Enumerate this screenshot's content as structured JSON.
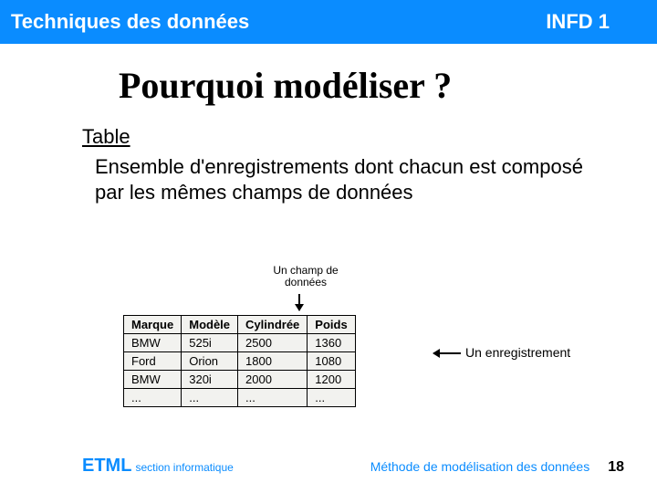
{
  "header": {
    "left": "Techniques des données",
    "right": "INFD 1"
  },
  "slide_title": "Pourquoi modéliser ?",
  "term": "Table",
  "definition": "Ensemble d'enregistrements dont chacun est composé par les mêmes champs de données",
  "annot_top": "Un champ de données",
  "annot_right": "Un enregistrement",
  "table": {
    "headers": [
      "Marque",
      "Modèle",
      "Cylindrée",
      "Poids"
    ],
    "rows": [
      [
        "BMW",
        "525i",
        "2500",
        "1360"
      ],
      [
        "Ford",
        "Orion",
        "1800",
        "1080"
      ],
      [
        "BMW",
        "320i",
        "2000",
        "1200"
      ],
      [
        "...",
        "...",
        "...",
        "..."
      ]
    ]
  },
  "footer": {
    "org": "ETML",
    "section": "section informatique",
    "subtitle": "Méthode de modélisation des données",
    "page": "18"
  }
}
